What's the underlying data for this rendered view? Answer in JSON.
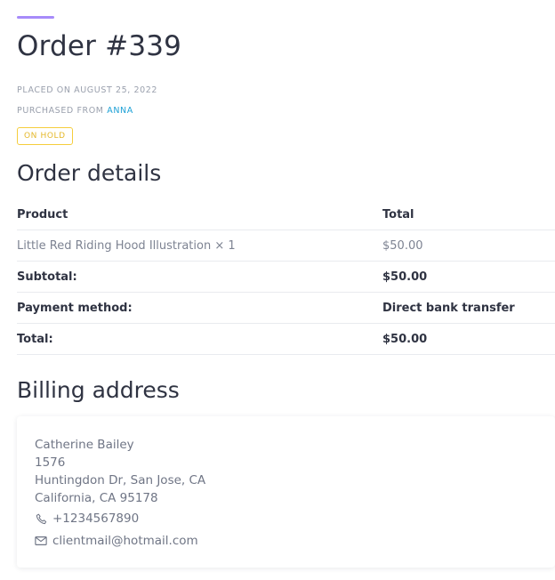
{
  "order": {
    "title": "Order #339",
    "placed_on": "PLACED ON AUGUST 25, 2022",
    "purchased_from_prefix": "PURCHASED FROM",
    "purchased_from_name": "ANNA",
    "status": "ON HOLD"
  },
  "colors": {
    "accent": "#a78bfa",
    "link": "#1ea1d6",
    "status_on_hold": "#f5cd3c"
  },
  "order_details": {
    "title": "Order details",
    "headers": [
      "Product",
      "Total"
    ],
    "rows": [
      {
        "label": "Little Red Riding Hood Illustration × 1",
        "value": "$50.00"
      },
      {
        "label": "Subtotal:",
        "value": "$50.00"
      },
      {
        "label": "Payment method:",
        "value": "Direct bank transfer"
      },
      {
        "label": "Total:",
        "value": "$50.00"
      }
    ]
  },
  "billing": {
    "title": "Billing address",
    "name": "Catherine Bailey",
    "line1": "1576",
    "line2": "Huntingdon Dr, San Jose, CA",
    "line3": "California, CA 95178",
    "phone_icon": "phone-icon",
    "phone": "+1234567890",
    "email_icon": "envelope-icon",
    "email": "clientmail@hotmail.com"
  }
}
